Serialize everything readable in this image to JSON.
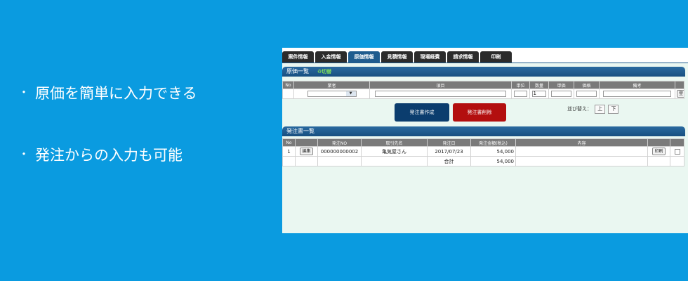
{
  "bullets": [
    {
      "text": "原価を簡単に入力できる"
    },
    {
      "text": "発注からの入力も可能"
    }
  ],
  "tabs": [
    {
      "label": "案件情報"
    },
    {
      "label": "入金情報"
    },
    {
      "label": "原価情報",
      "active": true
    },
    {
      "label": "見積情報"
    },
    {
      "label": "現場経費"
    },
    {
      "label": "請求情報"
    },
    {
      "label": "印刷"
    }
  ],
  "cost_section": {
    "title": "原価一覧",
    "refresh_label": "切替",
    "headers": [
      "No",
      "業者",
      "項目",
      "単位",
      "数量",
      "単価",
      "価格",
      "備考"
    ],
    "row": {
      "quantity": "1",
      "register_label": "登"
    }
  },
  "buttons": {
    "create_order": "発注書作成",
    "delete_order": "発注書削除",
    "accent_create": "#0b3d6e",
    "accent_delete": "#b30f0f"
  },
  "sort": {
    "label": "並び替え：",
    "up": "上",
    "down": "下"
  },
  "order_section": {
    "title": "発注書一覧",
    "headers": [
      "No",
      "",
      "発注NO",
      "取引先名",
      "発注日",
      "発注金額(税込)",
      "内容",
      "",
      ""
    ],
    "rows": [
      {
        "no": "1",
        "edit": "編集",
        "order_no": "000000000002",
        "vendor": "亀気屋さん",
        "date": "2017/07/23",
        "amount": "54,000",
        "content": "",
        "print": "印刷"
      }
    ],
    "total_label": "合計",
    "total_amount": "54,000"
  }
}
